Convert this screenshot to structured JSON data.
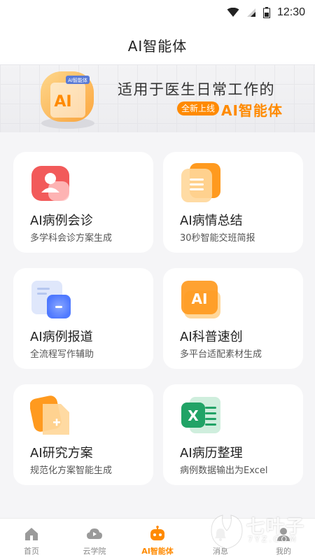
{
  "status_bar": {
    "time": "12:30"
  },
  "header": {
    "title": "AI智能体"
  },
  "banner": {
    "headline": "适用于医生日常工作的",
    "pill": "全新上线",
    "accent": "AI智能体",
    "art_label": "AI智能体",
    "art_letters": "AI"
  },
  "cards": [
    {
      "title": "AI病例会诊",
      "subtitle": "多学科会诊方案生成",
      "icon": "user-card-icon",
      "icon_color": "#f25a5a"
    },
    {
      "title": "AI病情总结",
      "subtitle": "30秒智能交班简报",
      "icon": "document-lines-icon",
      "icon_color": "#ff9a1f"
    },
    {
      "title": "AI病例报道",
      "subtitle": "全流程写作辅助",
      "icon": "report-icon",
      "icon_color": "#3d6bff"
    },
    {
      "title": "AI科普速创",
      "subtitle": "多平台适配素材生成",
      "icon": "ai-badge-icon",
      "icon_color": "#ff9a1f",
      "icon_text": "AI"
    },
    {
      "title": "AI研究方案",
      "subtitle": "规范化方案智能生成",
      "icon": "document-plus-icon",
      "icon_color": "#ff9a1f"
    },
    {
      "title": "AI病历整理",
      "subtitle": "病例数据输出为Excel",
      "icon": "excel-icon",
      "icon_color": "#21a366",
      "icon_text": "X"
    }
  ],
  "bottom_nav": [
    {
      "label": "首页",
      "icon": "home-icon",
      "active": false
    },
    {
      "label": "云学院",
      "icon": "cloud-play-icon",
      "active": false
    },
    {
      "label": "AI智能体",
      "icon": "robot-icon",
      "active": true
    },
    {
      "label": "消息",
      "icon": "bell-icon",
      "active": false
    },
    {
      "label": "我的",
      "icon": "profile-icon",
      "active": false
    }
  ],
  "watermark": {
    "text": "七叶子",
    "domain": "7YZ.COM"
  },
  "colors": {
    "accent": "#ff8a00",
    "background": "#f5f5f7",
    "card": "#ffffff"
  }
}
